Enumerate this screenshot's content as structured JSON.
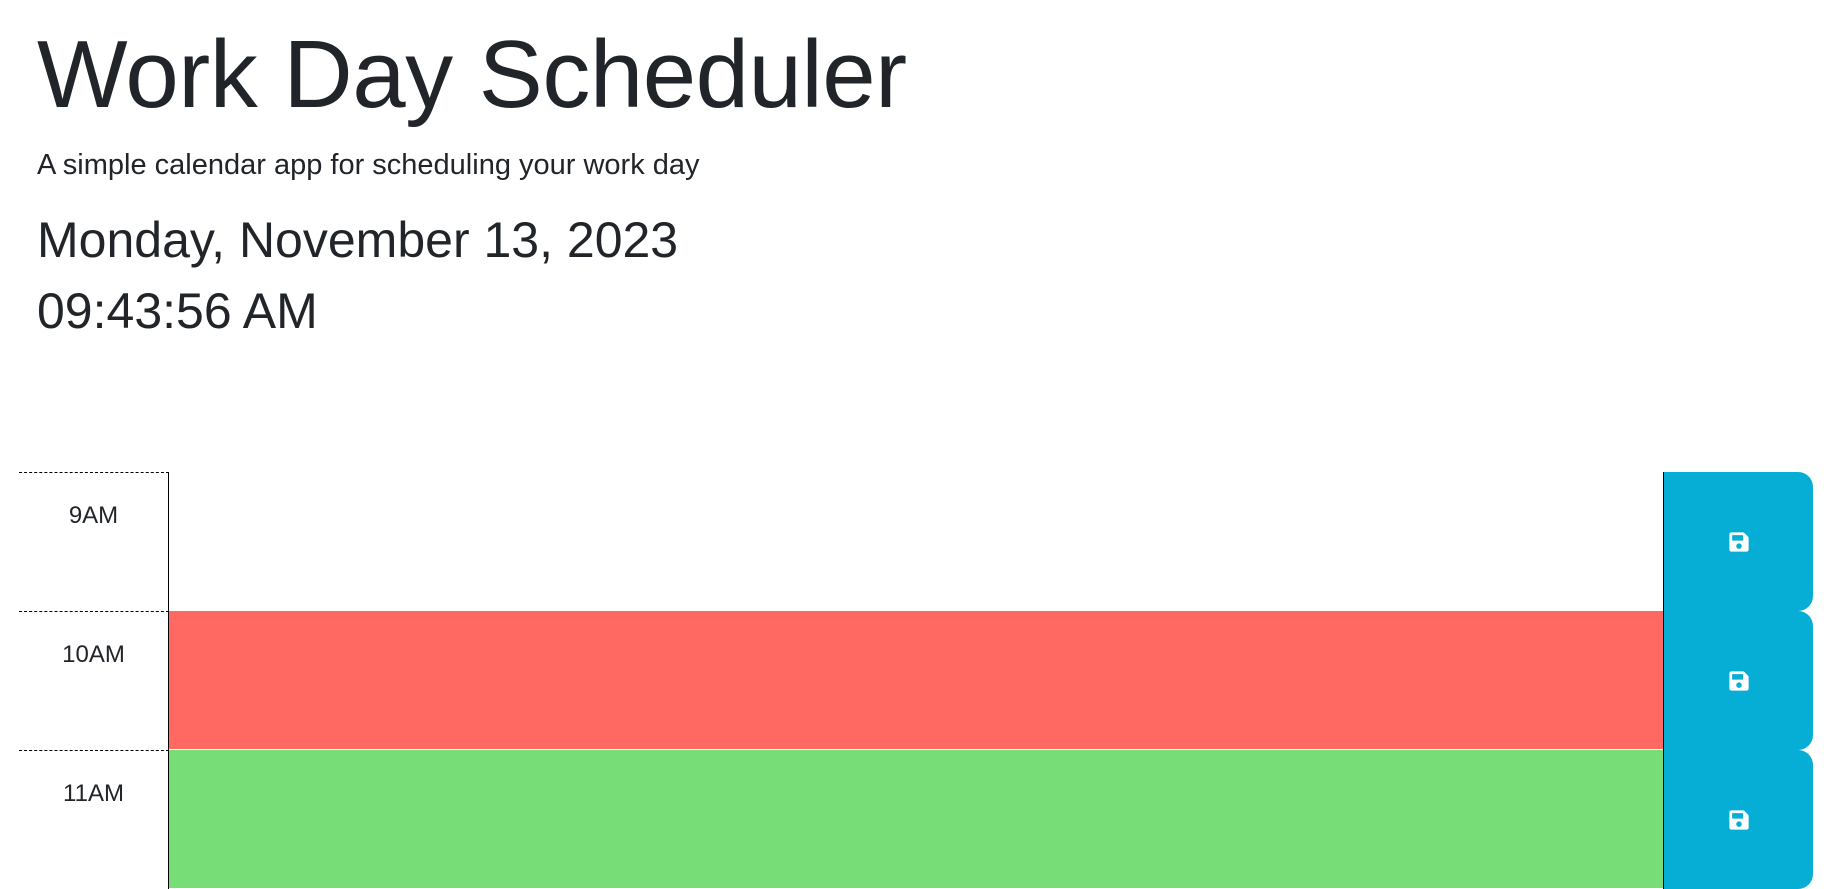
{
  "header": {
    "title": "Work Day Scheduler",
    "lead": "A simple calendar app for scheduling your work day",
    "date": "Monday, November 13, 2023",
    "time": "09:43:56 AM"
  },
  "rows": [
    {
      "hour": "9AM",
      "text": "",
      "state": "past"
    },
    {
      "hour": "10AM",
      "text": "",
      "state": "present"
    },
    {
      "hour": "11AM",
      "text": "",
      "state": "future"
    }
  ],
  "colors": {
    "past": "#ffffff",
    "present": "#ff6961",
    "future": "#77dd77",
    "save_button": "#06aed5"
  },
  "icons": {
    "save": "floppy-disk-icon"
  }
}
